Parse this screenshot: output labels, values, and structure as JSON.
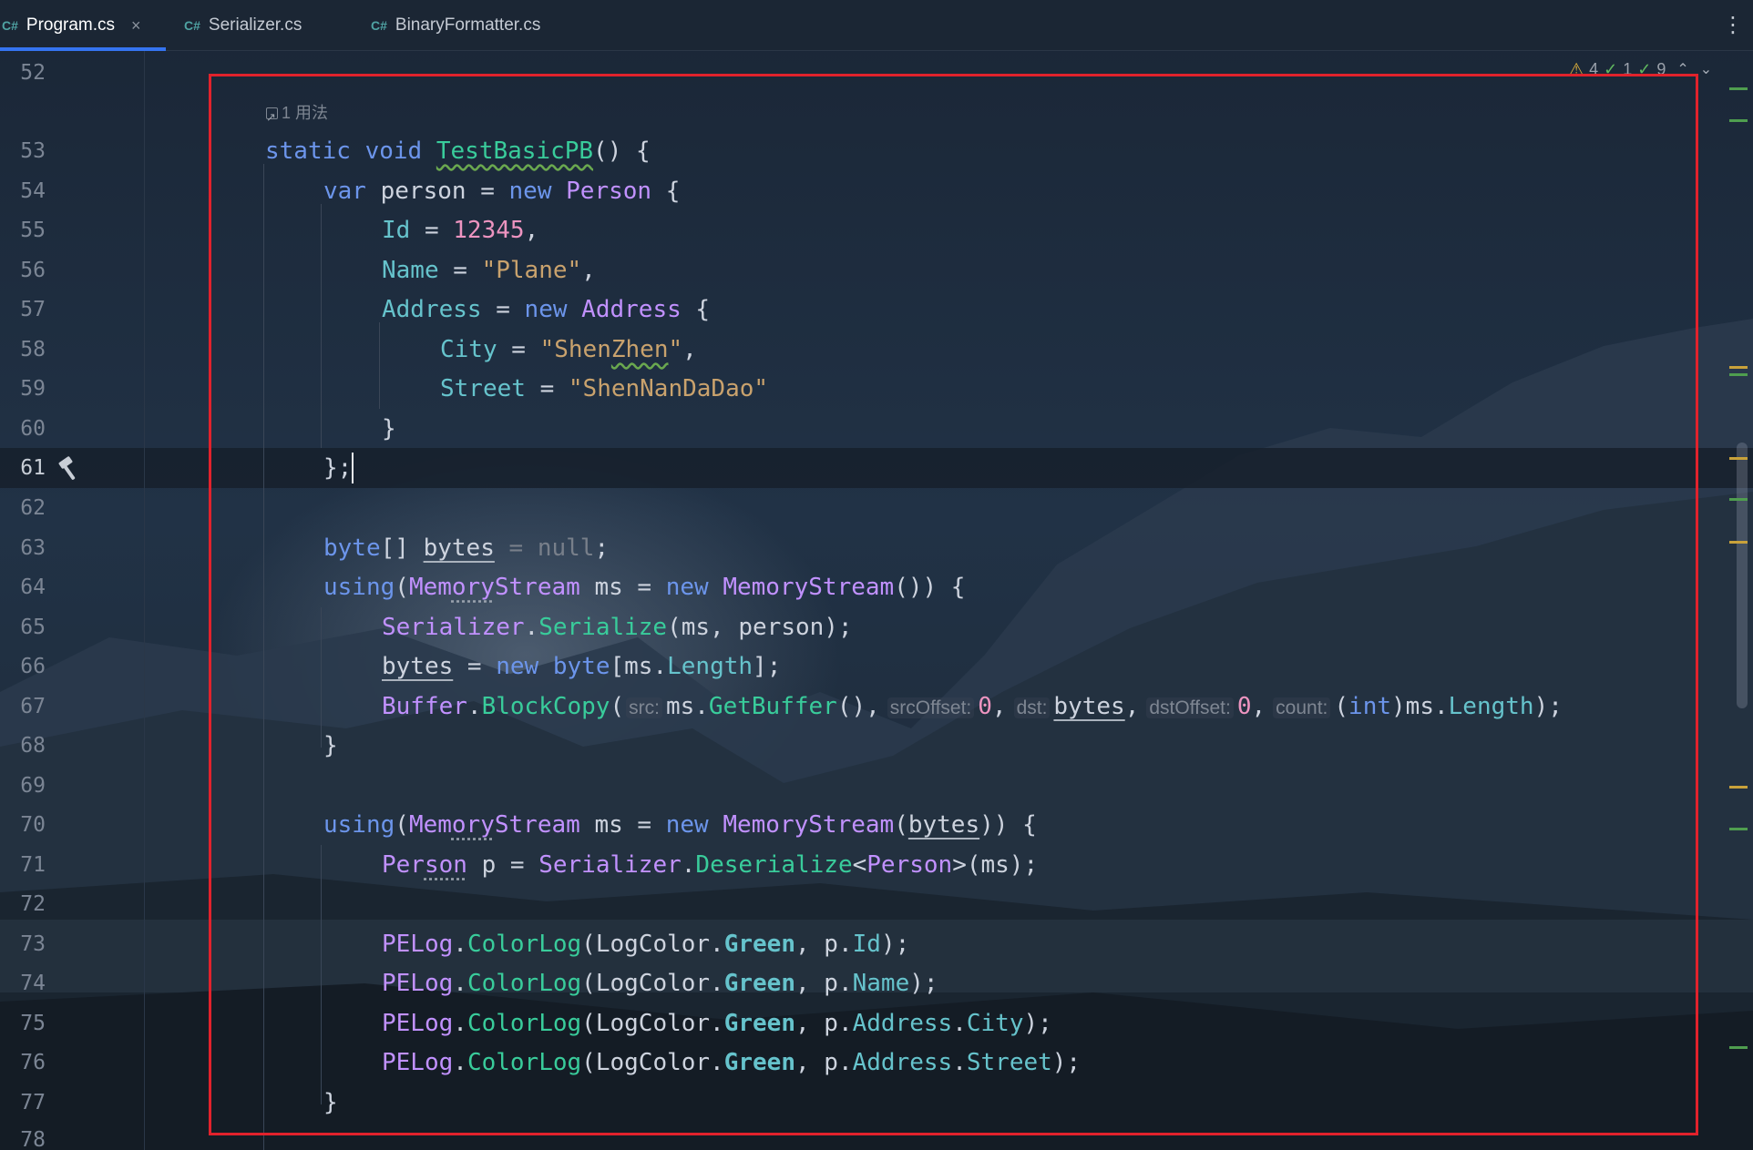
{
  "tabs": [
    {
      "icon": "C#",
      "label": "Program.cs",
      "close": "×"
    },
    {
      "icon": "C#",
      "label": "Serializer.cs"
    },
    {
      "icon": "C#",
      "label": "BinaryFormatter.cs"
    }
  ],
  "more_menu": "⋮",
  "inspections": {
    "warnings": "4",
    "ok": "1",
    "weak": "9",
    "up": "⌃",
    "down": "⌄"
  },
  "usage_hint": "1 用法",
  "line_numbers": [
    "52",
    "53",
    "54",
    "55",
    "56",
    "57",
    "58",
    "59",
    "60",
    "61",
    "62",
    "63",
    "64",
    "65",
    "66",
    "67",
    "68",
    "69",
    "70",
    "71",
    "72",
    "73",
    "74",
    "75",
    "76",
    "77",
    "78"
  ],
  "code": {
    "l53": {
      "kw1": "static",
      "kw2": "void",
      "fn": "TestBasicPB",
      "rest": "() {"
    },
    "l54": {
      "kw1": "var",
      "name": "person",
      "eq": " = ",
      "kw2": "new",
      "ty": "Person",
      "rest": " {"
    },
    "l55": {
      "prop": "Id",
      "eq": " = ",
      "num": "12345",
      "rest": ","
    },
    "l56": {
      "prop": "Name",
      "eq": " = ",
      "str": "\"Plane\"",
      "rest": ","
    },
    "l57": {
      "prop": "Address",
      "eq": " = ",
      "kw": "new",
      "ty": "Address",
      "rest": " {"
    },
    "l58": {
      "prop": "City",
      "eq": " = ",
      "str1": "\"Shen",
      "str2": "Zhen",
      "str3": "\"",
      "rest": ","
    },
    "l59": {
      "prop": "Street",
      "eq": " = ",
      "str": "\"ShenNanDaDao\""
    },
    "l60": {
      "text": "}"
    },
    "l61": {
      "text": "};"
    },
    "l63": {
      "kw": "byte",
      "br": "[] ",
      "name": "bytes",
      "eq": " = ",
      "nul": "null",
      "rest": ";"
    },
    "l64": {
      "kw1": "using",
      "p1": "(",
      "ty1a": "Mem",
      "ty1b": "ory",
      "ty1c": "Stream",
      "name": " ms = ",
      "kw2": "new",
      "ty2": "MemoryStream",
      "rest": "()) {"
    },
    "l65": {
      "ty": "Serializer",
      "dot": ".",
      "fn": "Serialize",
      "rest": "(ms, person);"
    },
    "l66": {
      "name": "bytes",
      "eq": " = ",
      "kw1": "new",
      "kw2": "byte",
      "p1": "[ms.",
      "prop": "Length",
      "rest": "];"
    },
    "l67": {
      "ty": "Buffer",
      "dot": ".",
      "fn": "BlockCopy",
      "p1": "(",
      "h1": "src:",
      "a1a": "ms.",
      "a1b": "GetBuffer",
      "a1c": "(),",
      "h2": "srcOffset:",
      "a2": "0",
      "c2": ",",
      "h3": "dst:",
      "a3": "bytes",
      "c3": ",",
      "h4": "dstOffset:",
      "a4": "0",
      "c4": ",",
      "h5": "count:",
      "a5a": "(",
      "a5b": "int",
      "a5c": ")ms.",
      "a5d": "Length",
      "rest": ");"
    },
    "l68": {
      "text": "}"
    },
    "l70": {
      "kw1": "using",
      "p1": "(",
      "ty1a": "Mem",
      "ty1b": "ory",
      "ty1c": "Stream",
      "name": " ms = ",
      "kw2": "new",
      "ty2": "MemoryStream",
      "p2": "(",
      "arg": "bytes",
      "rest": ")) {"
    },
    "l71": {
      "ty1a": "Per",
      "ty1b": "son",
      "name": " p = ",
      "ty2": "Serializer",
      "dot": ".",
      "fn": "Deserialize",
      "gen1": "<",
      "ty3": "Person",
      "rest": ">(ms);"
    },
    "l73": {
      "ty": "PELog",
      "dot": ".",
      "fn": "ColorLog",
      "p1": "(LogColor.",
      "en": "Green",
      "p2": ", p.",
      "prop": "Id",
      "rest": ");"
    },
    "l74": {
      "ty": "PELog",
      "dot": ".",
      "fn": "ColorLog",
      "p1": "(LogColor.",
      "en": "Green",
      "p2": ", p.",
      "prop": "Name",
      "rest": ");"
    },
    "l75": {
      "ty": "PELog",
      "dot": ".",
      "fn": "ColorLog",
      "p1": "(LogColor.",
      "en": "Green",
      "p2": ", p.",
      "prop1": "Address",
      "dot2": ".",
      "prop2": "City",
      "rest": ");"
    },
    "l76": {
      "ty": "PELog",
      "dot": ".",
      "fn": "ColorLog",
      "p1": "(LogColor.",
      "en": "Green",
      "p2": ", p.",
      "prop1": "Address",
      "dot2": ".",
      "prop2": "Street",
      "rest": ");"
    },
    "l77": {
      "text": "}"
    }
  },
  "colors": {
    "keyword": "#6c95eb",
    "type": "#c191ff",
    "method": "#39cc9b",
    "property": "#66c3cc",
    "string": "#c9a26d",
    "number": "#ed94c0",
    "highlight_box": "#e1222c",
    "tab_underline": "#3574f0"
  }
}
